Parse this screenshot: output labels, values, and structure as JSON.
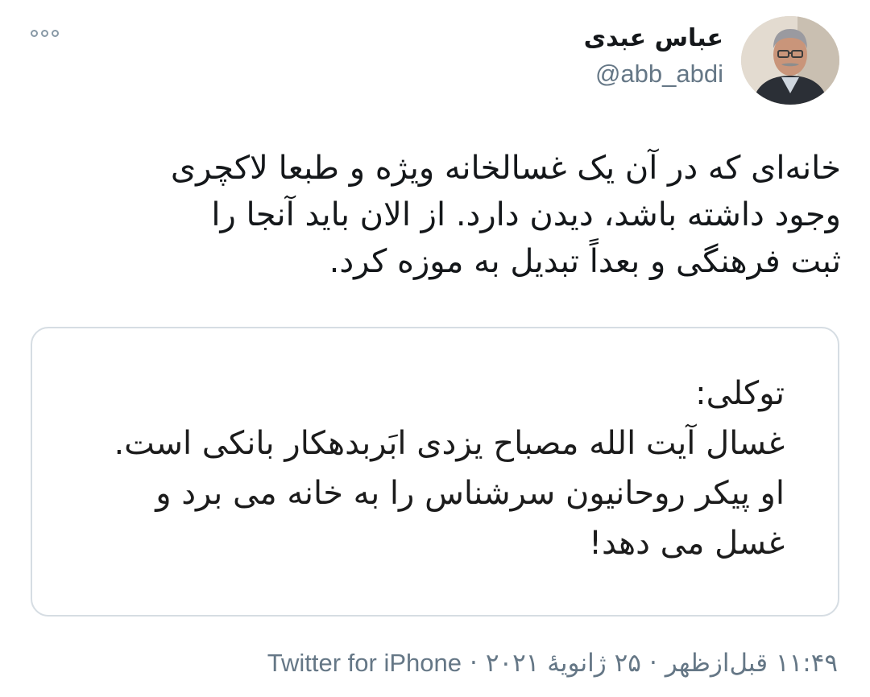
{
  "author": {
    "display_name": "عباس عبدی",
    "handle": "@abb_abdi"
  },
  "tweet": {
    "lines": [
      "خانه‌ای که در آن یک غسالخانه ویژه و طبعا لاکچری",
      "وجود داشته باشد، دیدن دارد. از الان باید آنجا را",
      "ثبت فرهنگی و بعداً تبدیل به موزه کرد."
    ]
  },
  "quote": {
    "lines": [
      "توکلی:",
      "غسال آیت الله مصباح یزدی ابَربدهکار بانکی است.",
      "او پیکر روحانیون سرشناس را به خانه می برد و",
      "غسل می دهد!"
    ]
  },
  "meta": {
    "time": "۱۱:۴۹ قبل‌ازظهر",
    "date": "۲۵ ژانویهٔ ۲۰۲۱",
    "separator": "·",
    "source": "Twitter for iPhone"
  },
  "icons": {
    "more": "more-options-icon"
  },
  "colors": {
    "secondary_text": "#657786",
    "border": "#d6dde3"
  }
}
